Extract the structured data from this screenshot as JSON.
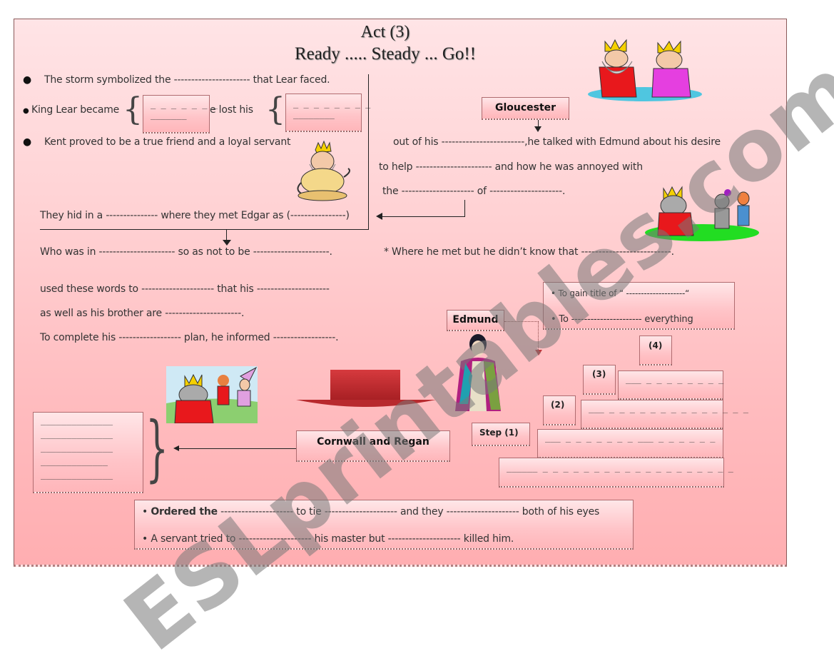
{
  "header": {
    "title_line1": "Act (3)",
    "title_line2": "Ready ..... Steady ... Go!!"
  },
  "left_section": {
    "line1": "The storm symbolized the ---------------------- that Lear faced.",
    "line2_a": "King Lear became",
    "line2_b": "e lost his",
    "box1_line1": "_ _ _ _ _ _ _",
    "box1_line2": "_______",
    "box2_line1": "_ _ _ _ _ _ _ _",
    "box2_line2": "________",
    "line3": "Kent proved to be a true friend and a loyal servant",
    "line4": "They hid in a --------------- where they met Edgar as  (----------------)",
    "line5": "Who was in ---------------------- so as not to be ----------------------."
  },
  "gloucester": {
    "label": "Gloucester",
    "line1": "out of his ------------------------,he  talked with Edmund about his desire",
    "line2": "to help ---------------------- and how he was annoyed with",
    "line3": "the --------------------- of ---------------------.",
    "line4": "* Where he met but he didn’t know   that --------------------------."
  },
  "middle_section": {
    "line1": "used these words to --------------------- that his ---------------------",
    "line2": "as well as  his brother are ----------------------.",
    "line3": "To complete his ------------------ plan, he informed ------------------."
  },
  "edmund": {
    "label": "Edmund",
    "goal1": "To gain title of  “ --------------------“",
    "goal2": "To ----------------------   everything",
    "steps": [
      {
        "label": "Step (1)",
        "answer": "___ _ _ _ _ _ _ _ ___ _ _ _ _ _ _"
      },
      {
        "label": "(2)",
        "answer": "___ _ _ _ _ _ _ _ _ _ _ _ _ _ _"
      },
      {
        "label": "(3)",
        "answer": "___ _ _ _ _ _ _ _ _"
      },
      {
        "label": "(4)",
        "answer": ""
      }
    ],
    "bottom_answer": "______ _ _ _ _ _ _ _ _ _ _ _ _ _ _ _ _ _ _ _"
  },
  "cornwall": {
    "label": "Cornwall and Regan",
    "answer_lines": [
      "______________",
      "______________",
      "______________",
      "_____________",
      "______________"
    ],
    "bottom_line1_bold": "Ordered the",
    "bottom_line1_rest": " --------------------- to tie --------------------- and they --------------------- both of his eyes",
    "bottom_line2": "A servant tried to --------------------- his master but --------------------- killed him."
  },
  "images": {
    "top_right": "two-kings-cartoon",
    "middle_left": "meditating-king-cartoon",
    "middle_right": "king-knight-boy-cartoon",
    "bottom_left": "king-queen-princess-cartoon",
    "edmund": "edmund-figure"
  },
  "watermark": "ESLprintables.com",
  "colors": {
    "sheet_top": "#ffe4e6",
    "sheet_bottom": "#ffaeb1",
    "box_border": "#b06c70",
    "arrow_red": "#c0393d"
  }
}
